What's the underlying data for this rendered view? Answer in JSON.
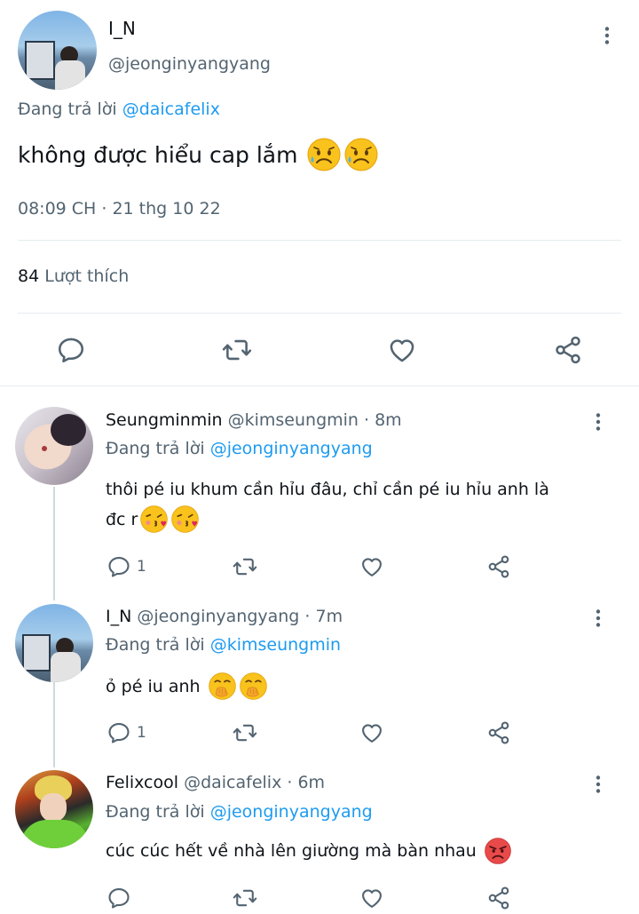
{
  "main_tweet": {
    "display_name": "I_N",
    "handle": "@jeonginyangyang",
    "reply_prefix": "Đang trả lời",
    "reply_to": "@daicafelix",
    "text": "không được hiểu cap lắm",
    "timestamp": "08:09 CH · 21 thg 10 22",
    "like_count": "84",
    "like_label": "Lượt thích"
  },
  "replies": [
    {
      "display_name": "Seungminmin",
      "handle_time": "@kimseungmin · 8m",
      "reply_prefix": "Đang trả lời",
      "reply_to": "@jeonginyangyang",
      "text_line1": "thôi pé iu khum cần hỉu đâu,  chỉ cần pé iu hỉu anh là",
      "text_line2": "đc r",
      "reply_count": "1"
    },
    {
      "display_name": "I_N",
      "handle_time": "@jeonginyangyang · 7m",
      "reply_prefix": "Đang trả lời",
      "reply_to": "@kimseungmin",
      "text": "ỏ pé iu anh",
      "reply_count": "1"
    },
    {
      "display_name": "Felixcool",
      "handle_time": "@daicafelix · 6m",
      "reply_prefix": "Đang trả lời",
      "reply_to": "@jeonginyangyang",
      "text": "cúc cúc hết về nhà lên giường mà bàn nhau",
      "reply_count": ""
    }
  ],
  "colors": {
    "link": "#1d9bf0",
    "muted": "#536471",
    "text": "#0f1419"
  }
}
